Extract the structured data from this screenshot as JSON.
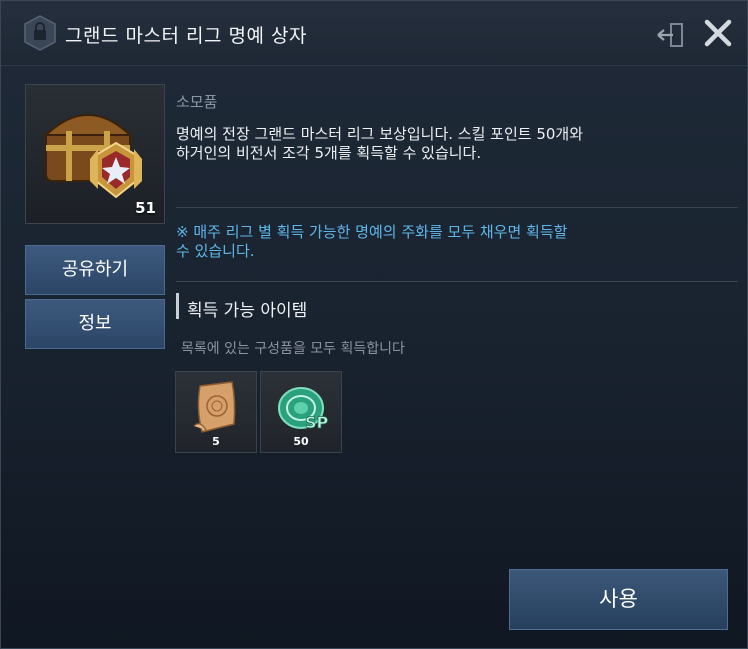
{
  "window": {
    "title": "그랜드 마스터 리그 명예 상자"
  },
  "item": {
    "count": "51",
    "category": "소모품",
    "description": "명예의 전장 그랜드 마스터 리그 보상입니다. 스킬 포인트 50개와 하거인의 비전서 조각 5개를 획득할 수 있습니다.",
    "notice": "※ 매주 리그 별 획득 가능한 명예의 주화를 모두 채우면 획득할 수 있습니다."
  },
  "buttons": {
    "share": "공유하기",
    "info": "정보",
    "use": "사용"
  },
  "rewards": {
    "title": "획득 가능 아이템",
    "subtitle": "목록에 있는 구성품을 모두 획득합니다",
    "items": [
      {
        "icon": "scroll-fragment-icon",
        "count": "5"
      },
      {
        "icon": "skill-point-sp-icon",
        "count": "50"
      }
    ]
  },
  "colors": {
    "notice": "#5fb6ea",
    "button": "#2b4566",
    "background": "#1a2431"
  }
}
